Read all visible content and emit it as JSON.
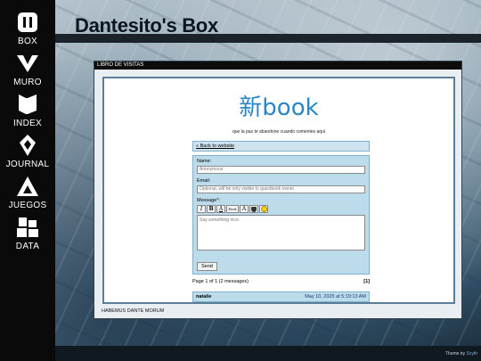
{
  "site": {
    "title": "Dantesito's Box"
  },
  "sidebar": {
    "items": [
      {
        "label": "BOX",
        "icon": "box-logo-icon"
      },
      {
        "label": "MURO",
        "icon": "chevron-down-icon"
      },
      {
        "label": "INDEX",
        "icon": "book-icon"
      },
      {
        "label": "JOURNAL",
        "icon": "pen-nib-icon"
      },
      {
        "label": "JUEGOS",
        "icon": "triangle-icon"
      },
      {
        "label": "DATA",
        "icon": "blocks-icon"
      }
    ]
  },
  "panel": {
    "header": "LIBRO DE VISITAS",
    "footer": "HABEMUS DANTE MORUM"
  },
  "guestbook": {
    "logo": "新book",
    "tagline": "que la paz te abandone cuando comentes aqui",
    "back_link": "« Back to website",
    "form": {
      "name_label": "Name:",
      "name_placeholder": "Anonymous",
      "email_label": "Email:",
      "email_placeholder": "Optional, will be only visible to guestbook owner.",
      "message_label": "Message*:",
      "toolbar": [
        "I",
        "B",
        "A",
        "Font",
        "A",
        "bucket",
        "smile"
      ],
      "message_placeholder": "Say something nice.",
      "send_label": "Send"
    },
    "pagination": {
      "text": "Page 1 of 1 (2 messages)",
      "page": "[1]"
    },
    "entries": [
      {
        "name": "natalie",
        "date": "May 10, 2025 at 5:19:13 AM"
      }
    ]
  },
  "footer": {
    "credit_prefix": "Theme by ",
    "credit_link": "Scyth"
  },
  "colors": {
    "accent": "#2a86c6",
    "form_bg": "#bcdcec",
    "sidebar_bg": "#0a0a0a"
  }
}
